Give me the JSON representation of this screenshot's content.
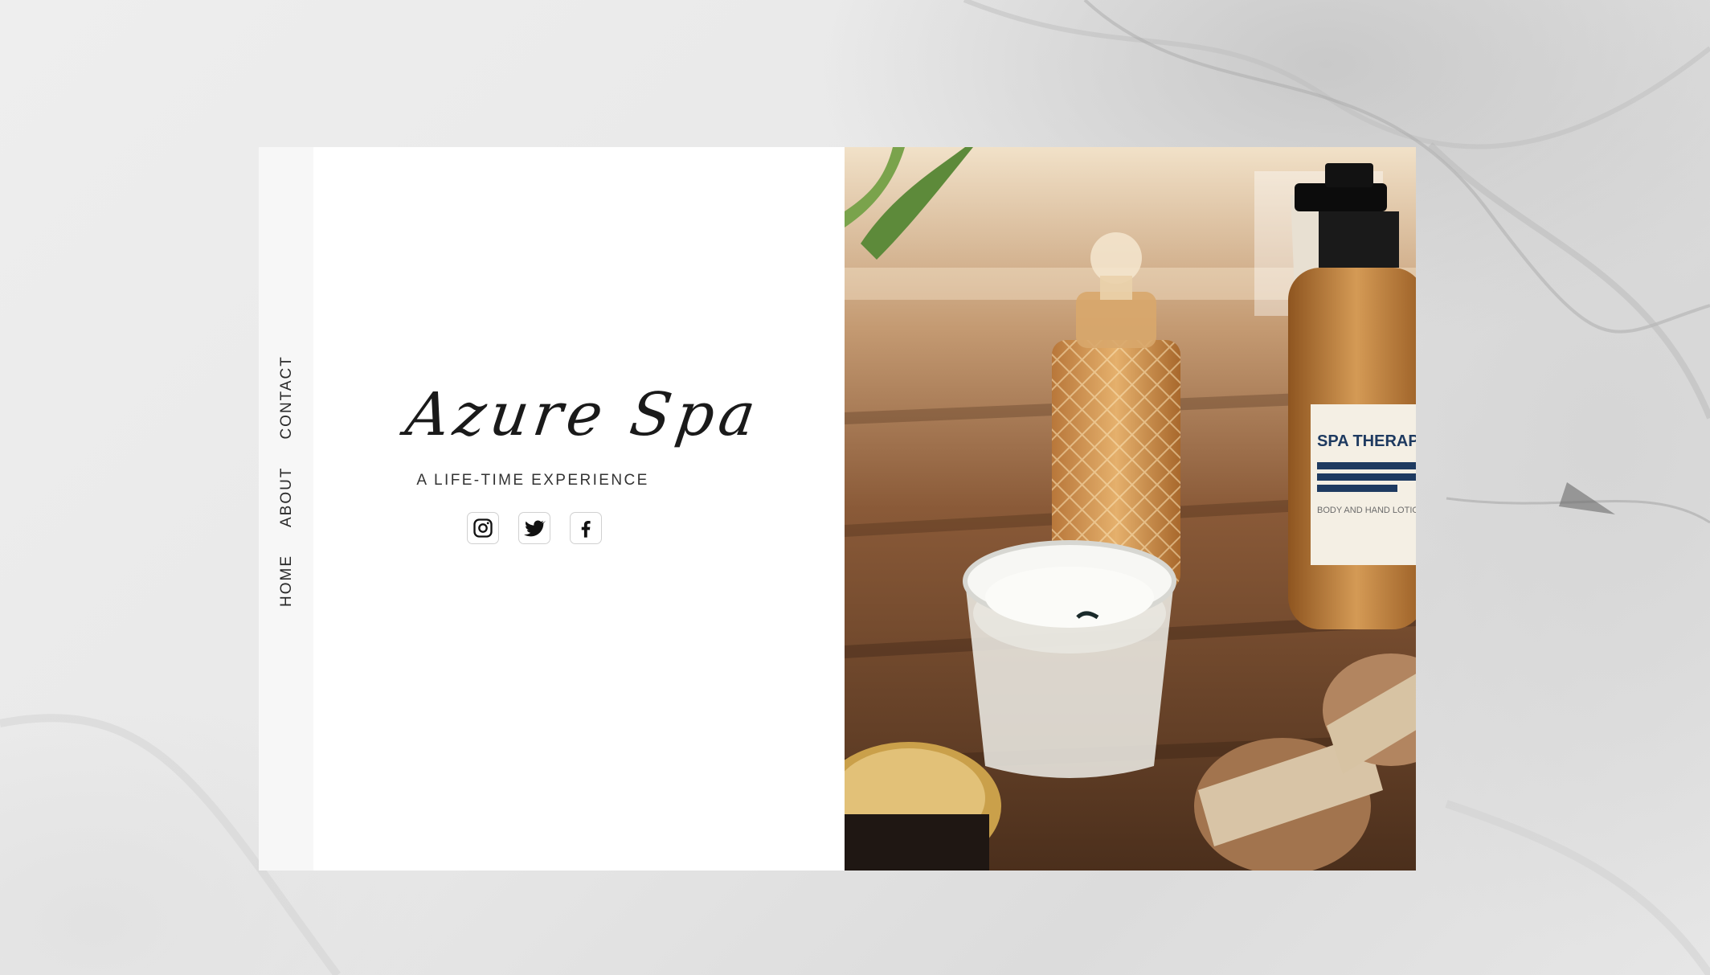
{
  "brand": {
    "title": "Azure Spa",
    "tagline": "A LIFE-TIME EXPERIENCE"
  },
  "nav": {
    "items": [
      {
        "label": "HOME"
      },
      {
        "label": "ABOUT"
      },
      {
        "label": "CONTACT"
      }
    ]
  },
  "social": {
    "items": [
      {
        "icon": "instagram-icon"
      },
      {
        "icon": "twitter-icon"
      },
      {
        "icon": "facebook-icon"
      }
    ]
  },
  "photo": {
    "label_text": "SPA THERAP",
    "label_subtext": "BODY AND HAND LOTION"
  },
  "colors": {
    "background": "#e9e9e9",
    "card": "#ffffff",
    "nav_rail": "#f7f7f7",
    "text": "#1a1a1a"
  }
}
